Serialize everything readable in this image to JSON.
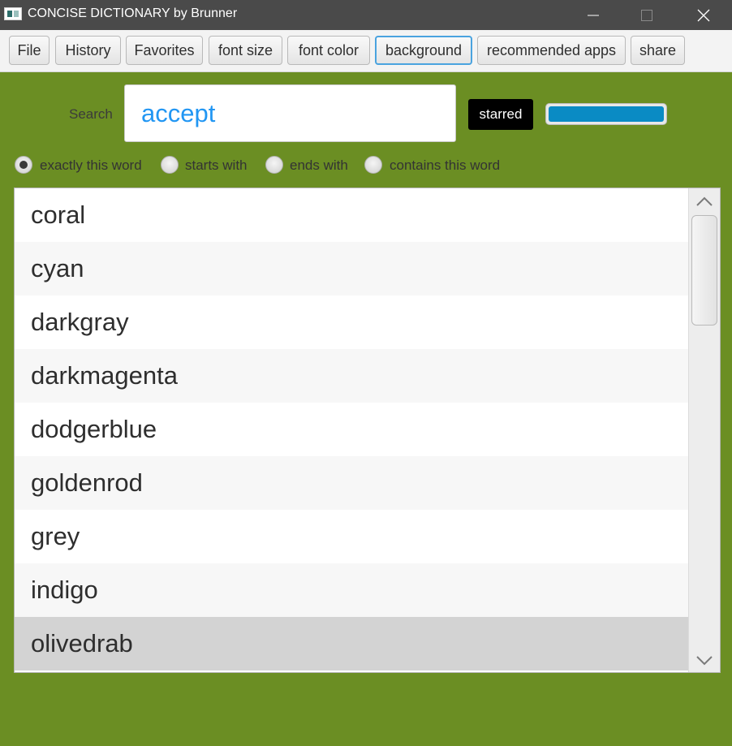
{
  "window": {
    "title": "CONCISE DICTIONARY by Brunner",
    "controls": [
      "minimize-icon",
      "maximize-icon",
      "close-icon"
    ]
  },
  "toolbar": {
    "file": "File",
    "history": "History",
    "favorites": "Favorites",
    "font_size": "font size",
    "font_color": "font color",
    "background": "background",
    "recommended_apps": "recommended apps",
    "share": "share"
  },
  "search": {
    "label": "Search",
    "value": "accept",
    "starred_label": "starred",
    "progress": 1.0
  },
  "match_modes": {
    "selected": "exactly this word",
    "options": [
      "exactly this word",
      "starts with",
      "ends with",
      "contains this word"
    ]
  },
  "results": {
    "items": [
      "coral",
      "cyan",
      "darkgray",
      "darkmagenta",
      "dodgerblue",
      "goldenrod",
      "grey",
      "indigo",
      "olivedrab"
    ],
    "selected": "olivedrab"
  },
  "colors": {
    "background": "#6b8e23",
    "titlebar": "#4a4a4a",
    "input_text": "#2196f3",
    "progress_fill": "#0a8bc4",
    "selected_row": "#d3d3d3"
  }
}
